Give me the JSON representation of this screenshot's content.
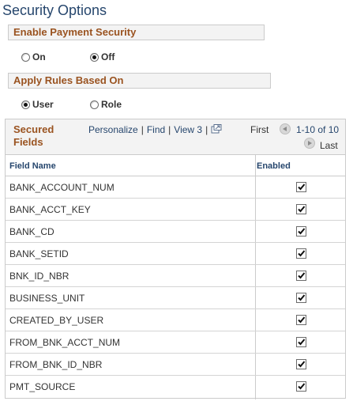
{
  "page": {
    "title": "Security Options"
  },
  "payment_security": {
    "header": "Enable Payment Security",
    "options": [
      {
        "label": "On",
        "selected": false
      },
      {
        "label": "Off",
        "selected": true
      }
    ]
  },
  "apply_rules": {
    "header": "Apply Rules Based On",
    "options": [
      {
        "label": "User",
        "selected": true
      },
      {
        "label": "Role",
        "selected": false
      }
    ]
  },
  "grid": {
    "title": "Secured Fields",
    "links": [
      "Personalize",
      "Find",
      "View 3"
    ],
    "first_label": "First",
    "range_label": "1-10 of 10",
    "last_label": "Last",
    "columns": [
      "Field Name",
      "Enabled"
    ],
    "rows": [
      {
        "field": "BANK_ACCOUNT_NUM",
        "enabled": true
      },
      {
        "field": "BANK_ACCT_KEY",
        "enabled": true
      },
      {
        "field": "BANK_CD",
        "enabled": true
      },
      {
        "field": "BANK_SETID",
        "enabled": true
      },
      {
        "field": "BNK_ID_NBR",
        "enabled": true
      },
      {
        "field": "BUSINESS_UNIT",
        "enabled": true
      },
      {
        "field": "CREATED_BY_USER",
        "enabled": true
      },
      {
        "field": "FROM_BNK_ACCT_NUM",
        "enabled": true
      },
      {
        "field": "FROM_BNK_ID_NBR",
        "enabled": true
      },
      {
        "field": "PMT_SOURCE",
        "enabled": true
      }
    ]
  },
  "colors": {
    "title_blue": "#26466d",
    "header_brown": "#9a5320",
    "header_bg": "#f3f3f3"
  }
}
